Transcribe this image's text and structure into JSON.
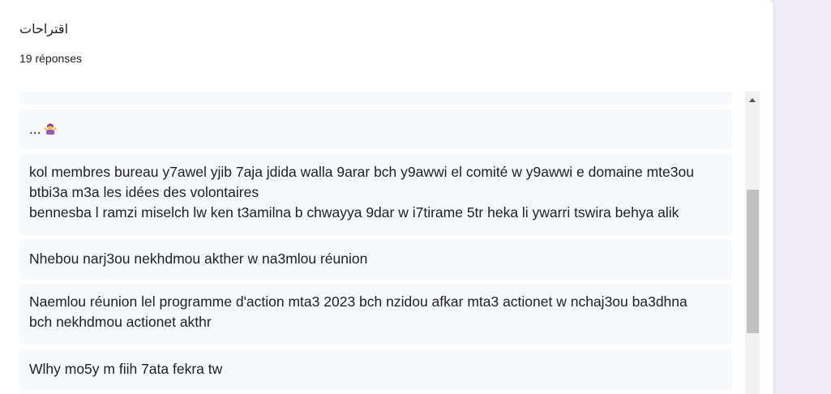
{
  "form_question": {
    "title": "اقتراحات",
    "response_count": "19 réponses"
  },
  "responses": [
    {
      "text": ""
    },
    {
      "text": "..."
    },
    {
      "lines": [
        "kol membres bureau y7awel yjib 7aja jdida walla 9arar bch y9awwi el comité w y9awwi e domaine mte3ou",
        "btbi3a m3a les idées des volontaires",
        "bennesba l ramzi miselch lw ken t3amilna b chwayya 9dar w i7tirame 5tr heka li ywarri tswira behya alik"
      ]
    },
    {
      "text": "Nhebou narj3ou nekhdmou akther w na3mlou réunion"
    },
    {
      "lines": [
        "Naemlou réunion lel programme d'action mta3 2023 bch nzidou afkar mta3 actionet w nchaj3ou ba3dhna",
        "bch nekhdmou actionet akthr"
      ]
    },
    {
      "text": "Wlhy mo5y m fiih 7ata fekra tw"
    }
  ],
  "emoji_icon": "woman-shrugging-emoji",
  "colors": {
    "card": "#ffffff",
    "page_background": "#efebf8",
    "response_background": "#f8f9fa",
    "scroll_thumb": "#c1c1c1"
  }
}
